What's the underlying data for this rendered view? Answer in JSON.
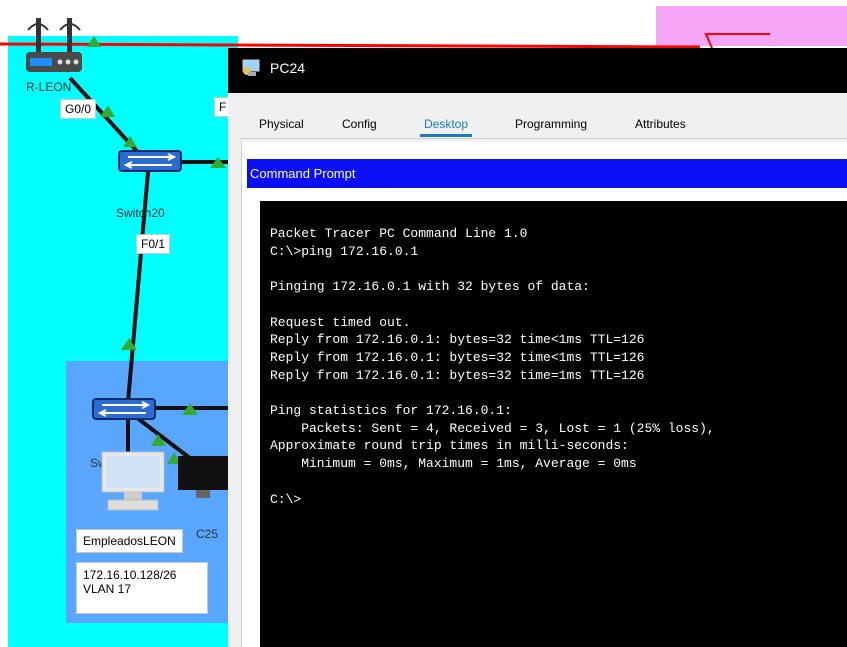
{
  "topology": {
    "router_label": "R-LEON",
    "port_g00": "G0/0",
    "port_f_partial": "F",
    "switch20_label": "Switch20",
    "port_f01": "F0/1",
    "switch10_label": "Switch10",
    "pc_label_partial": "C25",
    "network_name": "EmpleadosLEON",
    "subnet": "172.16.10.128/26",
    "vlan": "VLAN 17",
    "colors": {
      "canvas": "#00ffff",
      "vlan_area": "#58a6ff",
      "link_up": "#33aa33",
      "red_link": "#ff0000"
    }
  },
  "window": {
    "title": "PC24",
    "icon": "pc-icon"
  },
  "tabs": [
    {
      "label": "Physical",
      "active": false
    },
    {
      "label": "Config",
      "active": false
    },
    {
      "label": "Desktop",
      "active": true
    },
    {
      "label": "Programming",
      "active": false
    },
    {
      "label": "Attributes",
      "active": false
    }
  ],
  "command_prompt": {
    "header": "Command Prompt",
    "lines": [
      "Packet Tracer PC Command Line 1.0",
      "C:\\>ping 172.16.0.1",
      "",
      "Pinging 172.16.0.1 with 32 bytes of data:",
      "",
      "Request timed out.",
      "Reply from 172.16.0.1: bytes=32 time<1ms TTL=126",
      "Reply from 172.16.0.1: bytes=32 time<1ms TTL=126",
      "Reply from 172.16.0.1: bytes=32 time=1ms TTL=126",
      "",
      "Ping statistics for 172.16.0.1:",
      "    Packets: Sent = 4, Received = 3, Lost = 1 (25% loss),",
      "Approximate round trip times in milli-seconds:",
      "    Minimum = 0ms, Maximum = 1ms, Average = 0ms",
      "",
      "C:\\>"
    ]
  }
}
